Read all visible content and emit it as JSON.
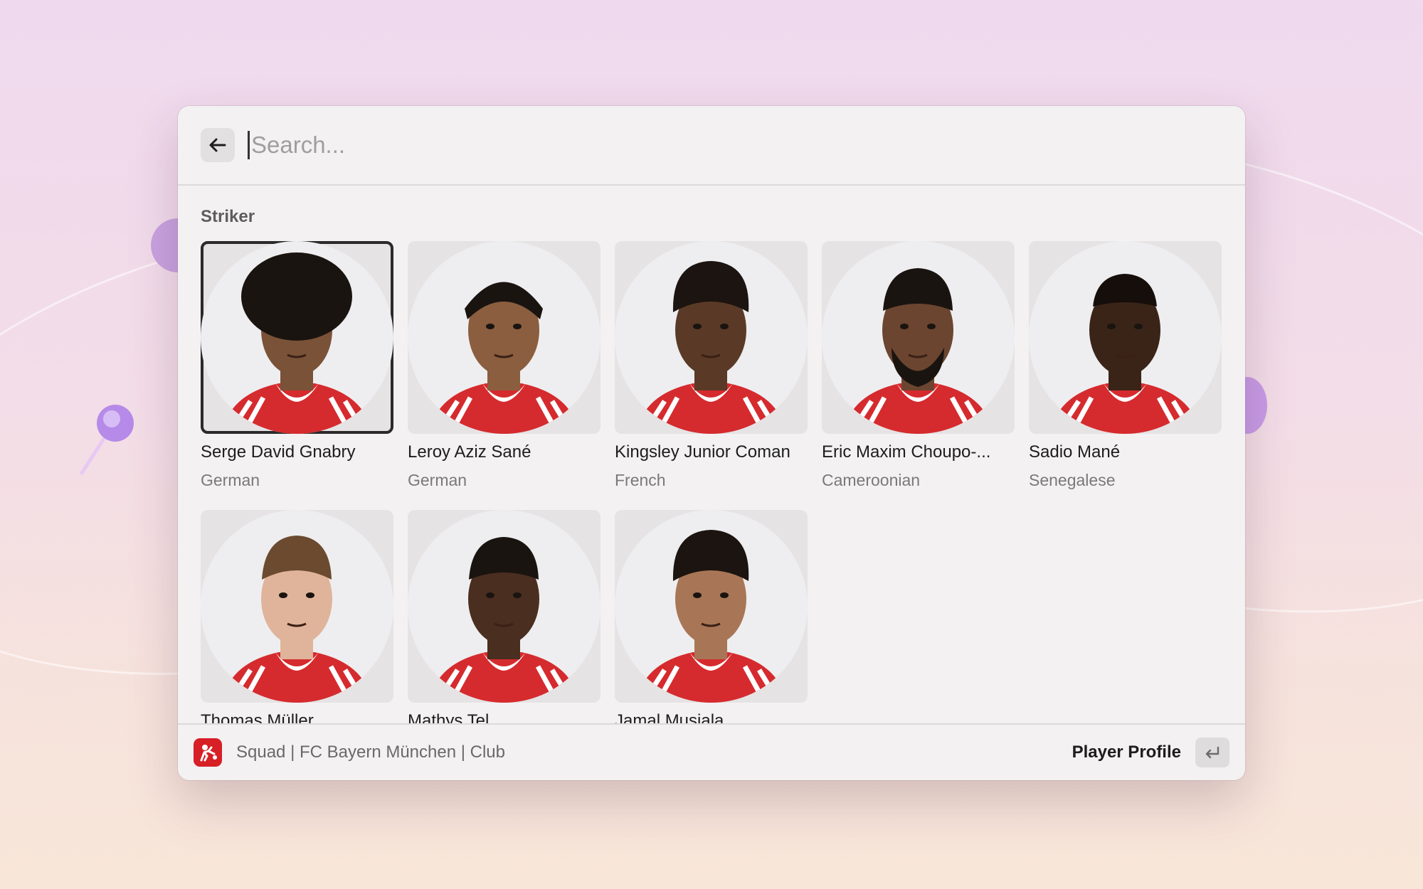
{
  "search": {
    "placeholder": "Search..."
  },
  "section": {
    "title": "Striker"
  },
  "players": [
    {
      "name": "Serge David Gnabry",
      "nationality": "German",
      "selected": true,
      "skin": "#7a5238",
      "hair": "afro"
    },
    {
      "name": "Leroy Aziz Sané",
      "nationality": "German",
      "selected": false,
      "skin": "#8b5e3f",
      "hair": "braids"
    },
    {
      "name": "Kingsley Junior Coman",
      "nationality": "French",
      "selected": false,
      "skin": "#5a3a26",
      "hair": "curly"
    },
    {
      "name": "Eric Maxim Choupo-...",
      "nationality": "Cameroonian",
      "selected": false,
      "skin": "#6b4530",
      "hair": "short"
    },
    {
      "name": "Sadio Mané",
      "nationality": "Senegalese",
      "selected": false,
      "skin": "#3a2418",
      "hair": "buzz"
    },
    {
      "name": "Thomas Müller",
      "nationality": "",
      "selected": false,
      "skin": "#e0b49a",
      "hair": "brown"
    },
    {
      "name": "Mathys Tel",
      "nationality": "",
      "selected": false,
      "skin": "#4a2e20",
      "hair": "short"
    },
    {
      "name": "Jamal Musiala",
      "nationality": "",
      "selected": false,
      "skin": "#a87656",
      "hair": "curly"
    }
  ],
  "footer": {
    "breadcrumb": "Squad | FC Bayern München | Club",
    "action": "Player Profile"
  },
  "colors": {
    "jersey_red": "#d52b2e",
    "logo_red": "#d71f26"
  },
  "icons": {
    "back": "arrow-left-icon",
    "enter": "return-key-icon",
    "logo": "bundesliga-logo-icon"
  }
}
